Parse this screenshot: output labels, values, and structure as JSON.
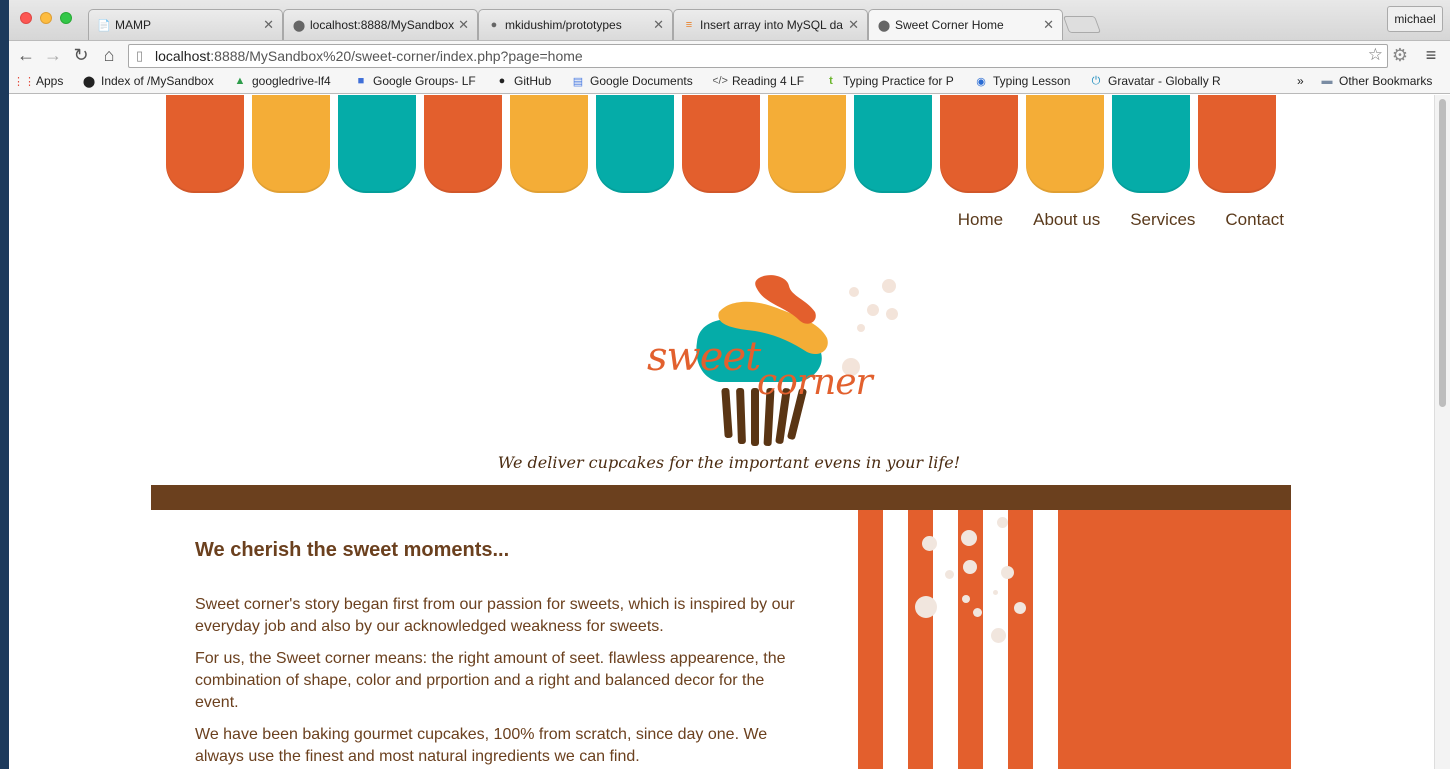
{
  "browser": {
    "profile_name": "michael",
    "tabs": [
      {
        "label": "MAMP",
        "icon": "page-icon"
      },
      {
        "label": "localhost:8888/MySandbox",
        "icon": "mamp-icon"
      },
      {
        "label": "mkidushim/prototypes",
        "icon": "github-icon"
      },
      {
        "label": "Insert array into MySQL da",
        "icon": "stackoverflow-icon"
      },
      {
        "label": "Sweet Corner Home",
        "icon": "mamp-icon",
        "active": true
      }
    ],
    "address": {
      "host": "localhost",
      "rest": ":8888/MySandbox%20/sweet-corner/index.php?page=home"
    },
    "bookmarks": [
      {
        "label": "Apps",
        "icon": "apps-grid-icon"
      },
      {
        "label": "Index of /MySandbox",
        "icon": "mamp-icon"
      },
      {
        "label": "googledrive-lf4",
        "icon": "drive-icon"
      },
      {
        "label": "Google Groups- LF",
        "icon": "groups-icon"
      },
      {
        "label": "GitHub",
        "icon": "github-icon"
      },
      {
        "label": "Google Documents",
        "icon": "docs-icon"
      },
      {
        "label": "Reading 4 LF",
        "icon": "code-icon"
      },
      {
        "label": "Typing Practice for P",
        "icon": "typing-icon"
      },
      {
        "label": "Typing Lesson",
        "icon": "cursor-icon"
      },
      {
        "label": "Gravatar - Globally R",
        "icon": "gravatar-icon"
      }
    ],
    "more_bookmarks": "»",
    "other_bookmarks": "Other Bookmarks"
  },
  "site": {
    "nav": [
      "Home",
      "About us",
      "Services",
      "Contact"
    ],
    "logo": {
      "word1": "sweet",
      "word2": "corner"
    },
    "tagline": "We deliver cupcakes for the important evens in your life!",
    "heading": "We cherish the sweet moments...",
    "paragraphs": [
      "Sweet corner's story began first from our passion for sweets, which is inspired by our everyday job and also by our acknowledged weakness for sweets.",
      "For us, the Sweet corner means: the right amount of seet. flawless appearence, the combination of shape, color and prportion and a right and balanced decor for the event.",
      "We have been baking gourmet cupcakes, 100% from scratch, since day one. We always use the finest and most natural ingredients we can find."
    ]
  },
  "colors": {
    "orange": "#e35f2d",
    "yellow": "#f4ad37",
    "teal": "#05aca8",
    "brown": "#6b401e"
  }
}
